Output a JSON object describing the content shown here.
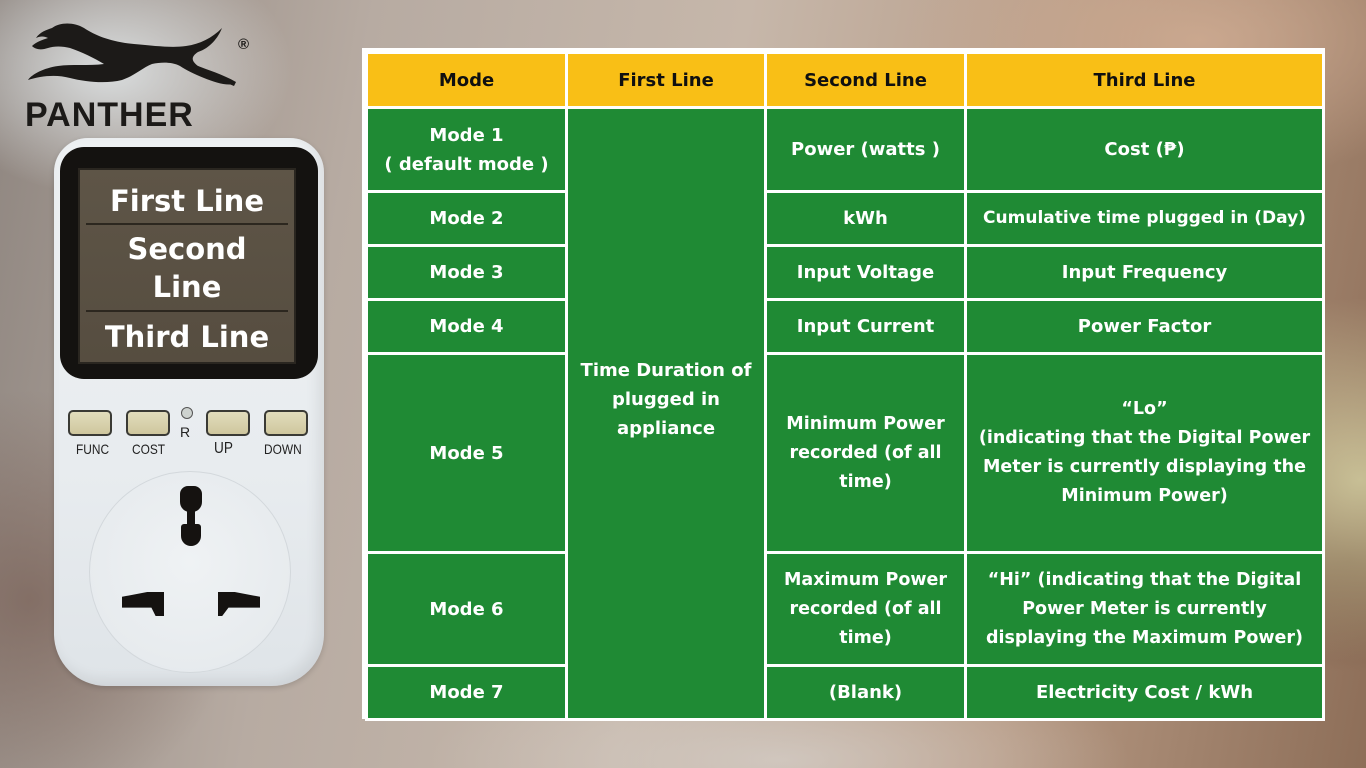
{
  "brand": {
    "name": "PANTHER",
    "registered_mark": "®",
    "logo_icon": "leaping-panther-icon"
  },
  "device": {
    "display_lines": [
      "First Line",
      "Second Line",
      "Third Line"
    ],
    "display_line_2_parts": [
      "Second",
      "Line"
    ],
    "buttons": [
      {
        "label": "FUNC"
      },
      {
        "label": "COST"
      },
      {
        "label": "UP"
      },
      {
        "label": "DOWN"
      }
    ],
    "reset_label": "R",
    "socket_icon": "universal-socket-icon"
  },
  "table": {
    "headers": [
      "Mode",
      "First Line",
      "Second Line",
      "Third Line"
    ],
    "first_line_shared": "Time Duration of plugged in appliance",
    "rows": [
      {
        "mode": "Mode 1",
        "mode_note": "( default mode )",
        "second": "Power (watts )",
        "third": "Cost  (₱)"
      },
      {
        "mode": "Mode 2",
        "second": "kWh",
        "third": "Cumulative time plugged in (Day)"
      },
      {
        "mode": "Mode 3",
        "second": "Input Voltage",
        "third": "Input Frequency"
      },
      {
        "mode": "Mode 4",
        "second": "Input Current",
        "third": "Power Factor"
      },
      {
        "mode": "Mode 5",
        "second": "Minimum Power recorded (of all time)",
        "third_title": "“Lo”",
        "third": "(indicating that the Digital Power Meter is currently displaying the Minimum Power)"
      },
      {
        "mode": "Mode 6",
        "second": "Maximum Power recorded (of all time)",
        "third": "“Hi” (indicating that the Digital Power Meter is currently displaying the Maximum Power)"
      },
      {
        "mode": "Mode 7",
        "second": "(Blank)",
        "third": "Electricity Cost / kWh"
      }
    ]
  },
  "colors": {
    "header_bg": "#f9bf16",
    "cell_bg": "#1f8a34",
    "grid_lines": "#ffffff"
  }
}
